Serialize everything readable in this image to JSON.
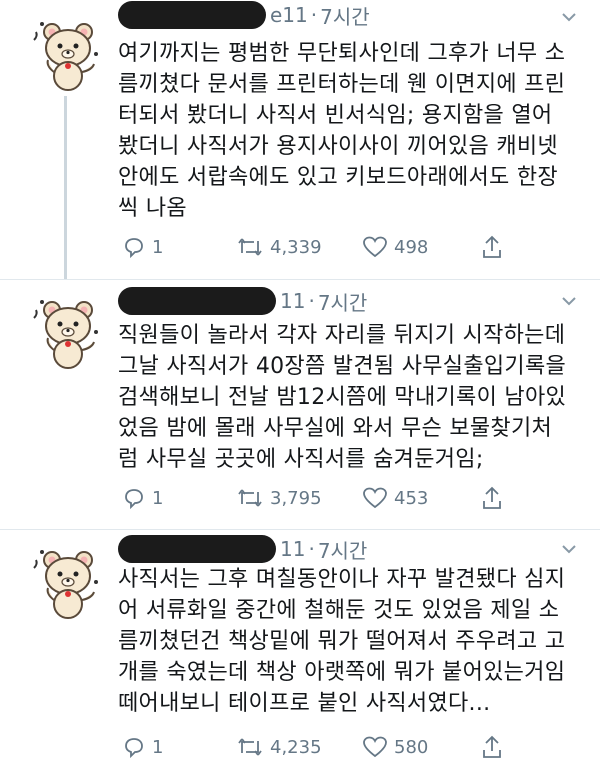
{
  "tweets": [
    {
      "handle_tail": "e11",
      "time": "7시간",
      "text": "여기까지는 평범한 무단퇴사인데 그후가 너무 소\n름끼쳤다 문서를 프린터하는데 웬 이면지에 프린\n터되서 봤더니 사직서 빈서식임; 용지함을 열어\n봤더니 사직서가 용지사이사이 끼어있음 캐비넷\n안에도 서랍속에도 있고 키보드아래에서도 한장\n씩 나옴",
      "replies": "1",
      "retweets": "4,339",
      "likes": "498"
    },
    {
      "handle_tail": "11",
      "time": "7시간",
      "text": "직원들이 놀라서 각자 자리를 뒤지기 시작하는데\n그날 사직서가 40장쯤 발견됨 사무실출입기록을\n검색해보니 전날 밤12시쯤에 막내기록이 남아있\n었음 밤에 몰래 사무실에 와서 무슨 보물찾기처\n럼 사무실 곳곳에 사직서를 숨겨둔거임;",
      "replies": "1",
      "retweets": "3,795",
      "likes": "453"
    },
    {
      "handle_tail": "11",
      "time": "7시간",
      "text": "사직서는 그후 며칠동안이나 자꾸 발견됐다 심지\n어 서류화일 중간에 철해둔 것도 있었음 제일 소\n름끼쳤던건 책상밑에 뭐가 떨어져서 주우려고 고\n개를 숙였는데 책상 아랫쪽에 뭐가 붙어있는거임\n떼어내보니 테이프로 붙인 사직서였다...",
      "replies": "1",
      "retweets": "4,235",
      "likes": "580"
    }
  ],
  "colors": {
    "text": "#14171a",
    "meta": "#657786",
    "line": "#ccd6dd"
  },
  "icons": [
    "bear-avatar",
    "chevron-down-icon",
    "reply-icon",
    "retweet-icon",
    "heart-icon",
    "share-icon"
  ]
}
